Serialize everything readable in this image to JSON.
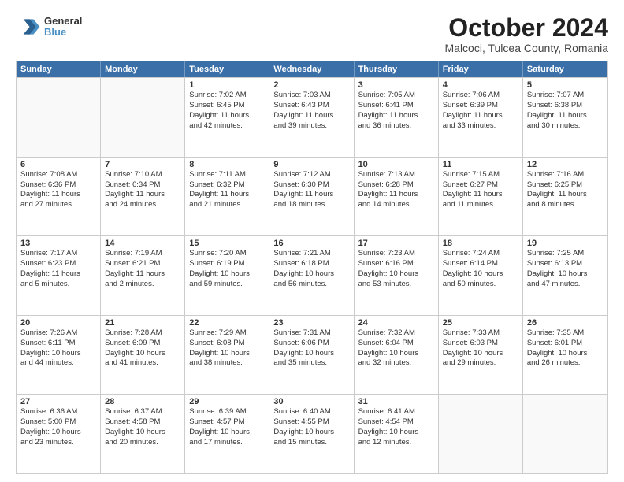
{
  "header": {
    "logo": {
      "line1": "General",
      "line2": "Blue"
    },
    "title": "October 2024",
    "location": "Malcoci, Tulcea County, Romania"
  },
  "days_of_week": [
    "Sunday",
    "Monday",
    "Tuesday",
    "Wednesday",
    "Thursday",
    "Friday",
    "Saturday"
  ],
  "weeks": [
    [
      {
        "day": "",
        "empty": true
      },
      {
        "day": "",
        "empty": true
      },
      {
        "day": "1",
        "lines": [
          "Sunrise: 7:02 AM",
          "Sunset: 6:45 PM",
          "Daylight: 11 hours",
          "and 42 minutes."
        ]
      },
      {
        "day": "2",
        "lines": [
          "Sunrise: 7:03 AM",
          "Sunset: 6:43 PM",
          "Daylight: 11 hours",
          "and 39 minutes."
        ]
      },
      {
        "day": "3",
        "lines": [
          "Sunrise: 7:05 AM",
          "Sunset: 6:41 PM",
          "Daylight: 11 hours",
          "and 36 minutes."
        ]
      },
      {
        "day": "4",
        "lines": [
          "Sunrise: 7:06 AM",
          "Sunset: 6:39 PM",
          "Daylight: 11 hours",
          "and 33 minutes."
        ]
      },
      {
        "day": "5",
        "lines": [
          "Sunrise: 7:07 AM",
          "Sunset: 6:38 PM",
          "Daylight: 11 hours",
          "and 30 minutes."
        ]
      }
    ],
    [
      {
        "day": "6",
        "lines": [
          "Sunrise: 7:08 AM",
          "Sunset: 6:36 PM",
          "Daylight: 11 hours",
          "and 27 minutes."
        ]
      },
      {
        "day": "7",
        "lines": [
          "Sunrise: 7:10 AM",
          "Sunset: 6:34 PM",
          "Daylight: 11 hours",
          "and 24 minutes."
        ]
      },
      {
        "day": "8",
        "lines": [
          "Sunrise: 7:11 AM",
          "Sunset: 6:32 PM",
          "Daylight: 11 hours",
          "and 21 minutes."
        ]
      },
      {
        "day": "9",
        "lines": [
          "Sunrise: 7:12 AM",
          "Sunset: 6:30 PM",
          "Daylight: 11 hours",
          "and 18 minutes."
        ]
      },
      {
        "day": "10",
        "lines": [
          "Sunrise: 7:13 AM",
          "Sunset: 6:28 PM",
          "Daylight: 11 hours",
          "and 14 minutes."
        ]
      },
      {
        "day": "11",
        "lines": [
          "Sunrise: 7:15 AM",
          "Sunset: 6:27 PM",
          "Daylight: 11 hours",
          "and 11 minutes."
        ]
      },
      {
        "day": "12",
        "lines": [
          "Sunrise: 7:16 AM",
          "Sunset: 6:25 PM",
          "Daylight: 11 hours",
          "and 8 minutes."
        ]
      }
    ],
    [
      {
        "day": "13",
        "lines": [
          "Sunrise: 7:17 AM",
          "Sunset: 6:23 PM",
          "Daylight: 11 hours",
          "and 5 minutes."
        ]
      },
      {
        "day": "14",
        "lines": [
          "Sunrise: 7:19 AM",
          "Sunset: 6:21 PM",
          "Daylight: 11 hours",
          "and 2 minutes."
        ]
      },
      {
        "day": "15",
        "lines": [
          "Sunrise: 7:20 AM",
          "Sunset: 6:19 PM",
          "Daylight: 10 hours",
          "and 59 minutes."
        ]
      },
      {
        "day": "16",
        "lines": [
          "Sunrise: 7:21 AM",
          "Sunset: 6:18 PM",
          "Daylight: 10 hours",
          "and 56 minutes."
        ]
      },
      {
        "day": "17",
        "lines": [
          "Sunrise: 7:23 AM",
          "Sunset: 6:16 PM",
          "Daylight: 10 hours",
          "and 53 minutes."
        ]
      },
      {
        "day": "18",
        "lines": [
          "Sunrise: 7:24 AM",
          "Sunset: 6:14 PM",
          "Daylight: 10 hours",
          "and 50 minutes."
        ]
      },
      {
        "day": "19",
        "lines": [
          "Sunrise: 7:25 AM",
          "Sunset: 6:13 PM",
          "Daylight: 10 hours",
          "and 47 minutes."
        ]
      }
    ],
    [
      {
        "day": "20",
        "lines": [
          "Sunrise: 7:26 AM",
          "Sunset: 6:11 PM",
          "Daylight: 10 hours",
          "and 44 minutes."
        ]
      },
      {
        "day": "21",
        "lines": [
          "Sunrise: 7:28 AM",
          "Sunset: 6:09 PM",
          "Daylight: 10 hours",
          "and 41 minutes."
        ]
      },
      {
        "day": "22",
        "lines": [
          "Sunrise: 7:29 AM",
          "Sunset: 6:08 PM",
          "Daylight: 10 hours",
          "and 38 minutes."
        ]
      },
      {
        "day": "23",
        "lines": [
          "Sunrise: 7:31 AM",
          "Sunset: 6:06 PM",
          "Daylight: 10 hours",
          "and 35 minutes."
        ]
      },
      {
        "day": "24",
        "lines": [
          "Sunrise: 7:32 AM",
          "Sunset: 6:04 PM",
          "Daylight: 10 hours",
          "and 32 minutes."
        ]
      },
      {
        "day": "25",
        "lines": [
          "Sunrise: 7:33 AM",
          "Sunset: 6:03 PM",
          "Daylight: 10 hours",
          "and 29 minutes."
        ]
      },
      {
        "day": "26",
        "lines": [
          "Sunrise: 7:35 AM",
          "Sunset: 6:01 PM",
          "Daylight: 10 hours",
          "and 26 minutes."
        ]
      }
    ],
    [
      {
        "day": "27",
        "lines": [
          "Sunrise: 6:36 AM",
          "Sunset: 5:00 PM",
          "Daylight: 10 hours",
          "and 23 minutes."
        ]
      },
      {
        "day": "28",
        "lines": [
          "Sunrise: 6:37 AM",
          "Sunset: 4:58 PM",
          "Daylight: 10 hours",
          "and 20 minutes."
        ]
      },
      {
        "day": "29",
        "lines": [
          "Sunrise: 6:39 AM",
          "Sunset: 4:57 PM",
          "Daylight: 10 hours",
          "and 17 minutes."
        ]
      },
      {
        "day": "30",
        "lines": [
          "Sunrise: 6:40 AM",
          "Sunset: 4:55 PM",
          "Daylight: 10 hours",
          "and 15 minutes."
        ]
      },
      {
        "day": "31",
        "lines": [
          "Sunrise: 6:41 AM",
          "Sunset: 4:54 PM",
          "Daylight: 10 hours",
          "and 12 minutes."
        ]
      },
      {
        "day": "",
        "empty": true
      },
      {
        "day": "",
        "empty": true
      }
    ]
  ]
}
